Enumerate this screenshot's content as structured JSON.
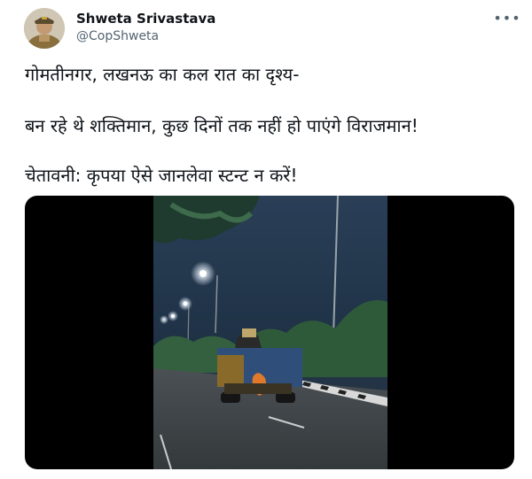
{
  "author": {
    "name": "Shweta Srivastava",
    "handle": "@CopShweta"
  },
  "tweet": {
    "lines": [
      "गोमतीनगर, लखनऊ का कल रात का दृश्य-",
      "बन रहे थे शक्तिमान, कुछ दिनों तक नहीं हो पाएंगे विराजमान!",
      "चेतावनी: कृपया ऐसे जानलेवा स्टन्ट न करें!"
    ]
  },
  "icons": {
    "more": "more-horizontal-icon"
  },
  "colors": {
    "text": "#0f1419",
    "secondary": "#536471",
    "video_background": "#000000"
  }
}
